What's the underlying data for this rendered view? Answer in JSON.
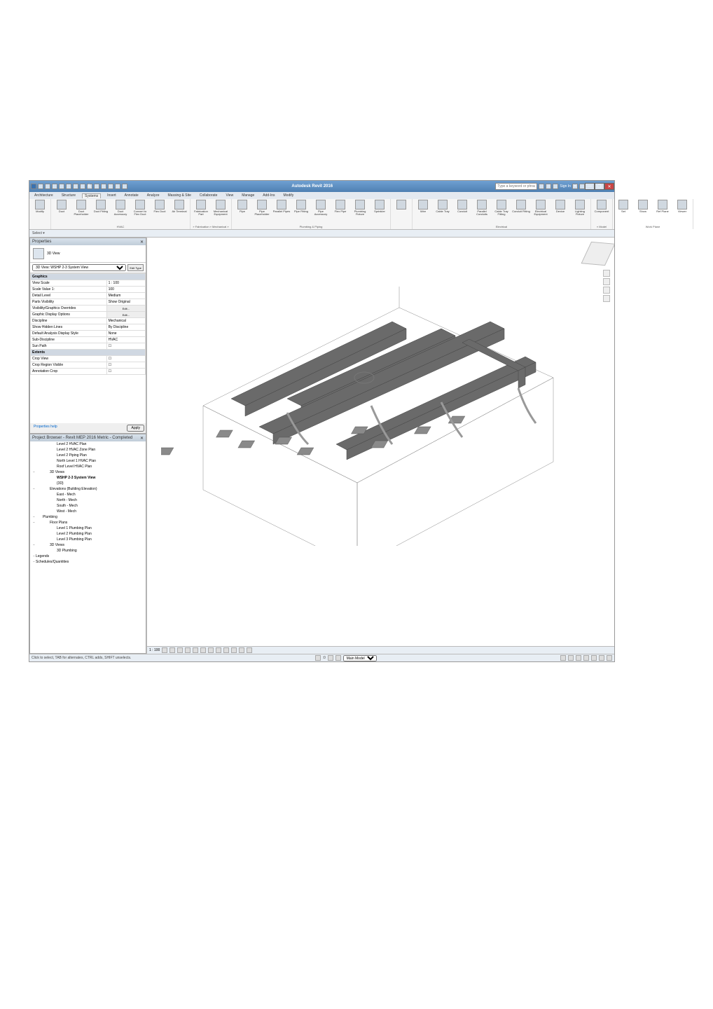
{
  "app": {
    "title": "Autodesk Revit 2016",
    "search_placeholder": "Type a keyword or phrase",
    "signin": "Sign In",
    "qat_icons": [
      "app-menu",
      "open",
      "save",
      "undo",
      "redo",
      "sep",
      "measure",
      "sep2",
      "text",
      "sep3",
      "dim",
      "align",
      "3d",
      "section",
      "thin",
      "close-hidden",
      "switch"
    ]
  },
  "menubar": {
    "tabs": [
      "Architecture",
      "Structure",
      "Systems",
      "Insert",
      "Annotate",
      "Analyze",
      "Massing & Site",
      "Collaborate",
      "View",
      "Manage",
      "Add-Ins",
      "Modify"
    ],
    "active": "Systems"
  },
  "ribbon": {
    "groups": [
      {
        "label": "",
        "items": [
          {
            "icon": "modify",
            "label": "Modify"
          }
        ]
      },
      {
        "label": "HVAC",
        "items": [
          {
            "icon": "duct",
            "label": "Duct"
          },
          {
            "icon": "duct-placeholder",
            "label": "Duct Placeholder"
          },
          {
            "icon": "duct-fitting",
            "label": "Duct Fitting"
          },
          {
            "icon": "duct-accessory",
            "label": "Duct Accessory"
          },
          {
            "icon": "flex-duct",
            "label": "Convert to Flex Duct"
          },
          {
            "icon": "flex",
            "label": "Flex Duct"
          },
          {
            "icon": "air-terminal",
            "label": "Air Terminal"
          }
        ]
      },
      {
        "label": "» Fabrication » Mechanical »",
        "items": [
          {
            "icon": "fab-part",
            "label": "Fabrication Part"
          },
          {
            "icon": "mech-equip",
            "label": "Mechanical Equipment"
          }
        ]
      },
      {
        "label": "Plumbing & Piping",
        "items": [
          {
            "icon": "pipe",
            "label": "Pipe"
          },
          {
            "icon": "pipe-placeholder",
            "label": "Pipe Placeholder"
          },
          {
            "icon": "parallel-pipes",
            "label": "Parallel Pipes"
          },
          {
            "icon": "pipe-fitting",
            "label": "Pipe Fitting"
          },
          {
            "icon": "pipe-accessory",
            "label": "Pipe Accessory"
          },
          {
            "icon": "flex-pipe",
            "label": "Flex Pipe"
          },
          {
            "icon": "plumbing-fixture",
            "label": "Plumbing Fixture"
          },
          {
            "icon": "sprinkler",
            "label": "Sprinkler"
          }
        ]
      },
      {
        "label": "",
        "items": [
          {
            "icon": "sep",
            "label": ""
          }
        ]
      },
      {
        "label": "Electrical",
        "items": [
          {
            "icon": "wire",
            "label": "Wire"
          },
          {
            "icon": "cable-tray",
            "label": "Cable Tray"
          },
          {
            "icon": "conduit",
            "label": "Conduit"
          },
          {
            "icon": "parallel-conduits",
            "label": "Parallel Conduits"
          },
          {
            "icon": "cable-tray-fitting",
            "label": "Cable Tray Fitting"
          },
          {
            "icon": "conduit-fitting",
            "label": "Conduit Fitting"
          },
          {
            "icon": "electrical-equipment",
            "label": "Electrical Equipment"
          },
          {
            "icon": "device",
            "label": "Device"
          },
          {
            "icon": "lighting-fixture",
            "label": "Lighting Fixture"
          }
        ]
      },
      {
        "label": "» Model",
        "items": [
          {
            "icon": "component",
            "label": "Component"
          }
        ]
      },
      {
        "label": "Work Plane",
        "items": [
          {
            "icon": "set",
            "label": "Set"
          },
          {
            "icon": "show",
            "label": "Show"
          },
          {
            "icon": "ref-plane",
            "label": "Ref Plane"
          },
          {
            "icon": "viewer",
            "label": "Viewer"
          }
        ]
      }
    ]
  },
  "quickbar": {
    "select_label": "Select ▾"
  },
  "properties": {
    "title": "Properties",
    "type_name": "3D View",
    "instance_label": "3D View: WSHP 2-3 System View",
    "edit_type": "Edit Type",
    "sections": [
      {
        "name": "Graphics",
        "rows": [
          {
            "k": "View Scale",
            "v": "1 : 100"
          },
          {
            "k": "Scale Value    1:",
            "v": "100"
          },
          {
            "k": "Detail Level",
            "v": "Medium"
          },
          {
            "k": "Parts Visibility",
            "v": "Show Original"
          },
          {
            "k": "Visibility/Graphics Overrides",
            "v": "Edit...",
            "btn": true
          },
          {
            "k": "Graphic Display Options",
            "v": "Edit...",
            "btn": true
          },
          {
            "k": "Discipline",
            "v": "Mechanical"
          },
          {
            "k": "Show Hidden Lines",
            "v": "By Discipline"
          },
          {
            "k": "Default Analysis Display Style",
            "v": "None"
          },
          {
            "k": "Sub-Discipline",
            "v": "HVAC"
          },
          {
            "k": "Sun Path",
            "v": "☐"
          }
        ]
      },
      {
        "name": "Extents",
        "rows": [
          {
            "k": "Crop View",
            "v": "☐"
          },
          {
            "k": "Crop Region Visible",
            "v": "☐"
          },
          {
            "k": "Annotation Crop",
            "v": "☐"
          }
        ]
      }
    ],
    "help_link": "Properties help",
    "apply": "Apply"
  },
  "browser": {
    "title": "Project Browser - Revit MEP 2016 Metric - Completed",
    "tree": [
      {
        "t": "Level 2 HVAC Plan",
        "l": 3,
        "leaf": true
      },
      {
        "t": "Level 2 HVAC Zone Plan",
        "l": 3,
        "leaf": true
      },
      {
        "t": "Level 2 Piping Plan",
        "l": 3,
        "leaf": true
      },
      {
        "t": "North Level 1 HVAC Plan",
        "l": 3,
        "leaf": true
      },
      {
        "t": "Roof Level HVAC Plan",
        "l": 3,
        "leaf": true
      },
      {
        "t": "3D Views",
        "l": 2
      },
      {
        "t": "WSHP 2-3 System View",
        "l": 3,
        "leaf": true,
        "bold": true
      },
      {
        "t": "{3D}",
        "l": 3,
        "leaf": true
      },
      {
        "t": "Elevations (Building Elevation)",
        "l": 2
      },
      {
        "t": "East - Mech",
        "l": 3,
        "leaf": true
      },
      {
        "t": "North - Mech",
        "l": 3,
        "leaf": true
      },
      {
        "t": "South - Mech",
        "l": 3,
        "leaf": true
      },
      {
        "t": "West - Mech",
        "l": 3,
        "leaf": true
      },
      {
        "t": "Plumbing",
        "l": 1
      },
      {
        "t": "Floor Plans",
        "l": 2
      },
      {
        "t": "Level 1 Plumbing Plan",
        "l": 3,
        "leaf": true
      },
      {
        "t": "Level 2 Plumbing Plan",
        "l": 3,
        "leaf": true
      },
      {
        "t": "Level 3 Plumbing Plan",
        "l": 3,
        "leaf": true
      },
      {
        "t": "3D Views",
        "l": 2
      },
      {
        "t": "3D Plumbing",
        "l": 3,
        "leaf": true
      },
      {
        "t": "Legends",
        "l": 0
      },
      {
        "t": "Schedules/Quantities",
        "l": 0
      }
    ]
  },
  "viewcontrol": {
    "scale": "1 : 100",
    "icons": [
      "detail",
      "visual",
      "sun",
      "shadow",
      "render",
      "crop",
      "show-crop",
      "unlock",
      "temp",
      "reveal",
      "constraints",
      "analytical"
    ]
  },
  "statusbar": {
    "tip": "Click to select, TAB for alternates, CTRL adds, SHIFT unselects.",
    "main_model": "Main Model",
    "zero": ":0"
  }
}
